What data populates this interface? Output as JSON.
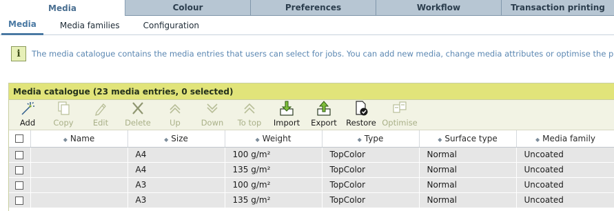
{
  "top_tabs": [
    {
      "label": "Media",
      "active": true
    },
    {
      "label": "Colour",
      "active": false
    },
    {
      "label": "Preferences",
      "active": false
    },
    {
      "label": "Workflow",
      "active": false
    },
    {
      "label": "Transaction printing",
      "active": false
    }
  ],
  "sub_tabs": [
    {
      "label": "Media",
      "active": true
    },
    {
      "label": "Media families",
      "active": false
    },
    {
      "label": "Configuration",
      "active": false
    }
  ],
  "info": {
    "icon": "info-icon",
    "text": "The media catalogue contains the media entries that users can select for jobs. You can add new media, change media attributes or optimise the print qu"
  },
  "catalogue": {
    "title": "Media catalogue (23 media entries, 0 selected)",
    "toolbar": [
      {
        "label": "Add",
        "icon": "sparkle-add-icon",
        "enabled": true
      },
      {
        "label": "Copy",
        "icon": "copy-icon",
        "enabled": false
      },
      {
        "label": "Edit",
        "icon": "pencil-icon",
        "enabled": false
      },
      {
        "label": "Delete",
        "icon": "x-delete-icon",
        "enabled": false
      },
      {
        "label": "Up",
        "icon": "chevron-up-icon",
        "enabled": false
      },
      {
        "label": "Down",
        "icon": "chevron-down-icon",
        "enabled": false
      },
      {
        "label": "To top",
        "icon": "to-top-icon",
        "enabled": false
      },
      {
        "label": "Import",
        "icon": "import-icon",
        "enabled": true
      },
      {
        "label": "Export",
        "icon": "export-icon",
        "enabled": true
      },
      {
        "label": "Restore",
        "icon": "restore-icon",
        "enabled": true
      },
      {
        "label": "Optimise",
        "icon": "optimise-icon",
        "enabled": false
      }
    ],
    "columns": [
      "Name",
      "Size",
      "Weight",
      "Type",
      "Surface type",
      "Media family"
    ],
    "rows": [
      {
        "name": "",
        "size": "A4",
        "weight": "100 g/m²",
        "type": "TopColor",
        "surface": "Normal",
        "family": "Uncoated"
      },
      {
        "name": "",
        "size": "A4",
        "weight": "135 g/m²",
        "type": "TopColor",
        "surface": "Normal",
        "family": "Uncoated"
      },
      {
        "name": "",
        "size": "A3",
        "weight": "100 g/m²",
        "type": "TopColor",
        "surface": "Normal",
        "family": "Uncoated"
      },
      {
        "name": "",
        "size": "A3",
        "weight": "135 g/m²",
        "type": "TopColor",
        "surface": "Normal",
        "family": "Uncoated"
      }
    ]
  },
  "colors": {
    "accent": "#4a79a3",
    "tab_inactive": "#b7c6d3",
    "panel_header": "#e1e47a",
    "toolbar_bg": "#f2f3e4",
    "row_bg": "#e6e6e6"
  }
}
